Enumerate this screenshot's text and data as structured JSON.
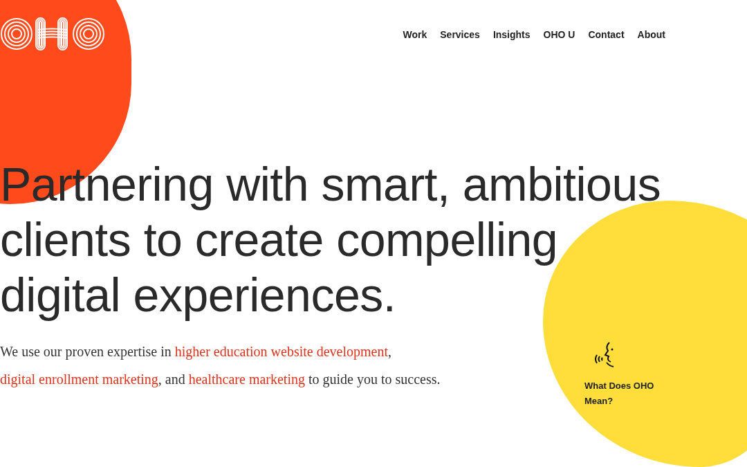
{
  "nav": [
    {
      "label": "Work"
    },
    {
      "label": "Services"
    },
    {
      "label": "Insights"
    },
    {
      "label": "OHO U"
    },
    {
      "label": "Contact"
    },
    {
      "label": "About"
    }
  ],
  "headline": "Partnering with smart, ambitious clients to create compelling digital experiences.",
  "intro": [
    {
      "kind": "text",
      "text": "We use our proven expertise in "
    },
    {
      "kind": "link",
      "text": "higher education website development"
    },
    {
      "kind": "text",
      "text": ", "
    },
    {
      "kind": "link",
      "text": "digital enrollment marketing"
    },
    {
      "kind": "text",
      "text": ", and "
    },
    {
      "kind": "link",
      "text": "healthcare marketing"
    },
    {
      "kind": "text",
      "text": " to guide you to success."
    }
  ],
  "callout": {
    "label": "What Does OHO Mean?"
  }
}
